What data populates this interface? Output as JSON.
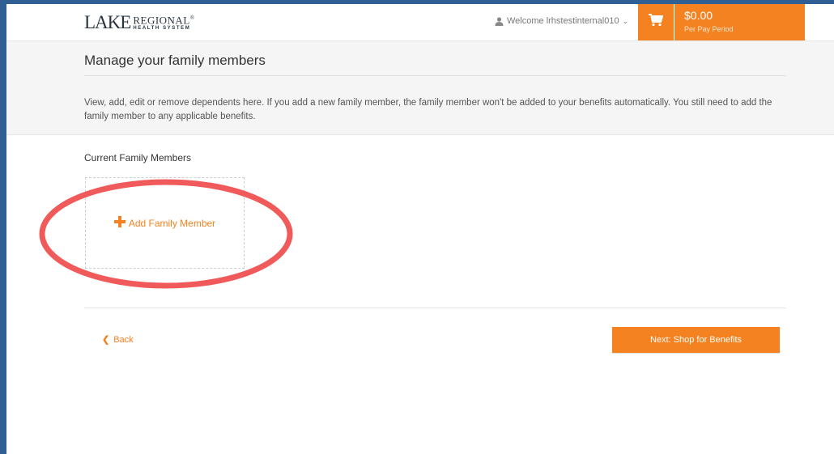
{
  "header": {
    "logo": {
      "lake": "LAKE",
      "regional": "REGIONAL",
      "registered": "®",
      "tagline": "HEALTH SYSTEM"
    },
    "welcome_text": "Welcome lrhstestinternal010",
    "cart_icon": "shopping-cart-icon",
    "price": "$0.00",
    "price_period": "Per Pay Period"
  },
  "page": {
    "title": "Manage your family members",
    "description": "View, add, edit or remove dependents here. If you add a new family member, the family member won't be added to your benefits automatically. You still need to add the family member to any applicable benefits.",
    "section_label": "Current Family Members",
    "add_member_label": "Add Family Member"
  },
  "footer_nav": {
    "back_label": "Back",
    "next_label": "Next: Shop for Benefits"
  },
  "colors": {
    "accent": "#f58220",
    "highlight": "#f05a5a",
    "outer_background": "#2f5f93"
  }
}
